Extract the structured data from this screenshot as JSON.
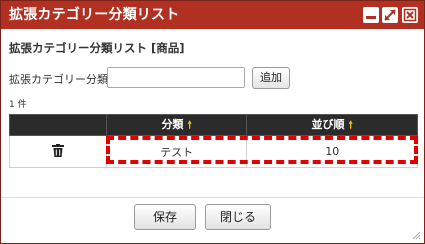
{
  "window": {
    "title": "拡張カテゴリー分類リスト",
    "minimize_icon": "minimize-icon",
    "maximize_icon": "maximize-icon",
    "close_icon": "close-icon",
    "accent_color": "#b13021"
  },
  "main": {
    "heading": "拡張カテゴリー分類リスト [商品]",
    "filter": {
      "label": "拡張カテゴリー分類",
      "value": "",
      "placeholder": ""
    },
    "add_label": "追加",
    "count_text": "1 件",
    "table": {
      "columns": [
        "",
        "分類",
        "並び順"
      ],
      "sort_icon": "sort-asc-icon",
      "rows": [
        {
          "icon": "trash-icon",
          "category": "テスト",
          "order": "10"
        }
      ]
    }
  },
  "footer": {
    "save_label": "保存",
    "close_label": "閉じる"
  }
}
